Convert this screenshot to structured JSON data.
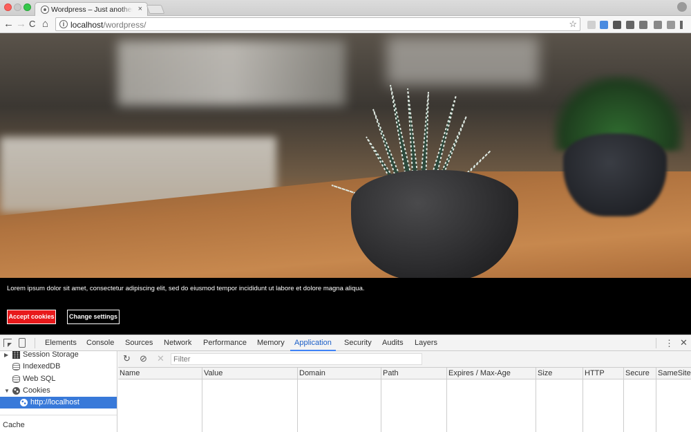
{
  "browser": {
    "tab_title": "Wordpress – Just another WordPress site",
    "tab_close": "×",
    "url_host": "localhost",
    "url_path": "/wordpress/",
    "nav_back": "←",
    "nav_forward": "→",
    "nav_reload": "C",
    "nav_home": "⌂",
    "info_glyph": "i",
    "star_glyph": "☆"
  },
  "page": {
    "cookie_text": "Lorem ipsum dolor sit amet, consectetur adipiscing elit, sed do eiusmod tempor incididunt ut labore et dolore magna aliqua.",
    "accept_label": "Accept cookies",
    "change_label": "Change settings"
  },
  "devtools": {
    "tabs": [
      "Elements",
      "Console",
      "Sources",
      "Network",
      "Performance",
      "Memory",
      "Application",
      "Security",
      "Audits",
      "Layers"
    ],
    "active_tab": "Application",
    "menu_glyph": "⋮",
    "close_glyph": "✕",
    "sidebar": {
      "items": [
        {
          "label": "Session Storage",
          "arrow": "▶"
        },
        {
          "label": "IndexedDB"
        },
        {
          "label": "Web SQL"
        },
        {
          "label": "Cookies",
          "arrow": "▼"
        },
        {
          "label": "http://localhost"
        }
      ],
      "section": "Cache"
    },
    "toolbar": {
      "refresh_glyph": "↻",
      "clear_glyph": "⊘",
      "delete_glyph": "✕",
      "filter_placeholder": "Filter"
    },
    "columns": [
      "Name",
      "Value",
      "Domain",
      "Path",
      "Expires / Max-Age",
      "Size",
      "HTTP",
      "Secure",
      "SameSite"
    ]
  },
  "colors": {
    "accent": "#e8191b",
    "selection": "#3879d9",
    "active_tab": "#1a5ec7"
  }
}
